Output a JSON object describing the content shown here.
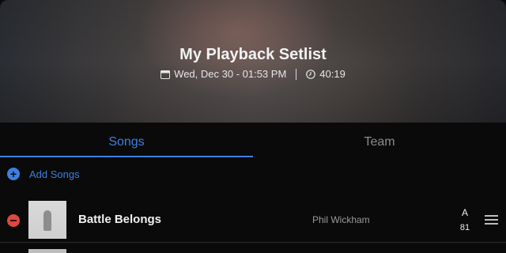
{
  "header": {
    "title": "My Playback Setlist",
    "date": "Wed, Dec 30 - 01:53 PM",
    "duration": "40:19",
    "calendar_icon": "calendar-icon",
    "clock_icon": "clock-icon"
  },
  "tabs": [
    {
      "label": "Songs",
      "active": true
    },
    {
      "label": "Team",
      "active": false
    }
  ],
  "add_songs": {
    "label": "Add Songs",
    "icon": "plus-circle-icon"
  },
  "songs": [
    {
      "title": "Battle Belongs",
      "artist": "Phil Wickham",
      "key": "A",
      "bpm": "81"
    }
  ],
  "colors": {
    "accent": "#3d7fe0",
    "remove": "#e0473e",
    "background": "#0a0a0a"
  }
}
